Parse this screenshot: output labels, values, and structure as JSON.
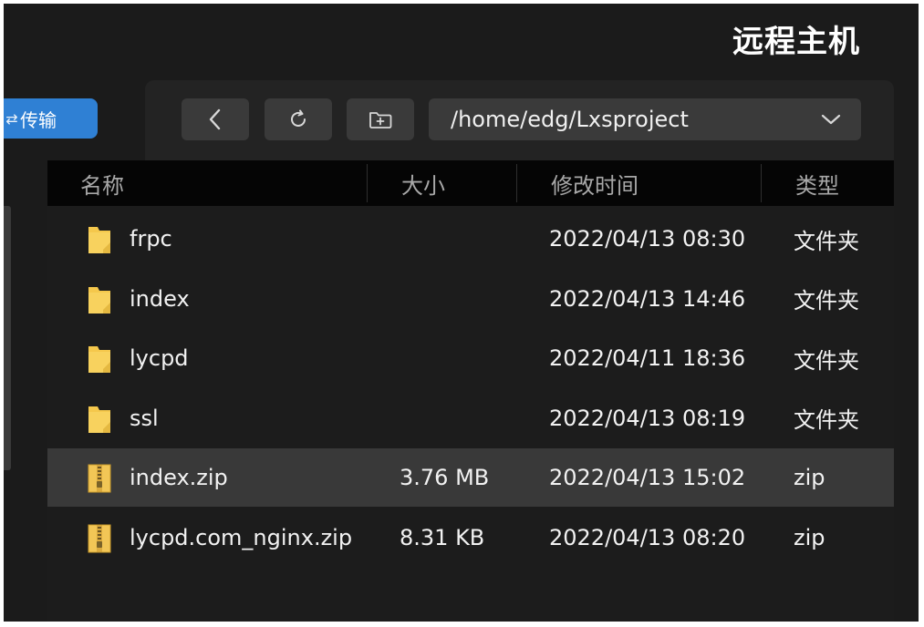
{
  "header": {
    "title": "远程主机"
  },
  "sidebar": {
    "transfer_label": "传输",
    "transfer_icon": "transfer-icon"
  },
  "toolbar": {
    "back_icon": "chevron-left-icon",
    "refresh_icon": "refresh-icon",
    "new_folder_icon": "new-folder-icon",
    "path": "/home/edg/Lxsproject",
    "dropdown_icon": "chevron-down-icon"
  },
  "table": {
    "columns": {
      "name": "名称",
      "size": "大小",
      "modified": "修改时间",
      "type": "类型"
    },
    "rows": [
      {
        "icon": "folder-icon",
        "name": "frpc",
        "size": "",
        "modified": "2022/04/13 08:30",
        "type": "文件夹"
      },
      {
        "icon": "folder-icon",
        "name": "index",
        "size": "",
        "modified": "2022/04/13 14:46",
        "type": "文件夹"
      },
      {
        "icon": "folder-icon",
        "name": "lycpd",
        "size": "",
        "modified": "2022/04/11 18:36",
        "type": "文件夹"
      },
      {
        "icon": "folder-icon",
        "name": "ssl",
        "size": "",
        "modified": "2022/04/13 08:19",
        "type": "文件夹"
      },
      {
        "icon": "zip-file-icon",
        "name": "index.zip",
        "size": "3.76 MB",
        "modified": "2022/04/13 15:02",
        "type": "zip",
        "selected": true
      },
      {
        "icon": "zip-file-icon",
        "name": "lycpd.com_nginx.zip",
        "size": "8.31 KB",
        "modified": "2022/04/13 08:20",
        "type": "zip"
      }
    ]
  },
  "colors": {
    "background": "#1b1b1b",
    "panel": "#232323",
    "accent": "#2f80d4",
    "folder": "#f5c84c",
    "selected_row": "#393939"
  }
}
